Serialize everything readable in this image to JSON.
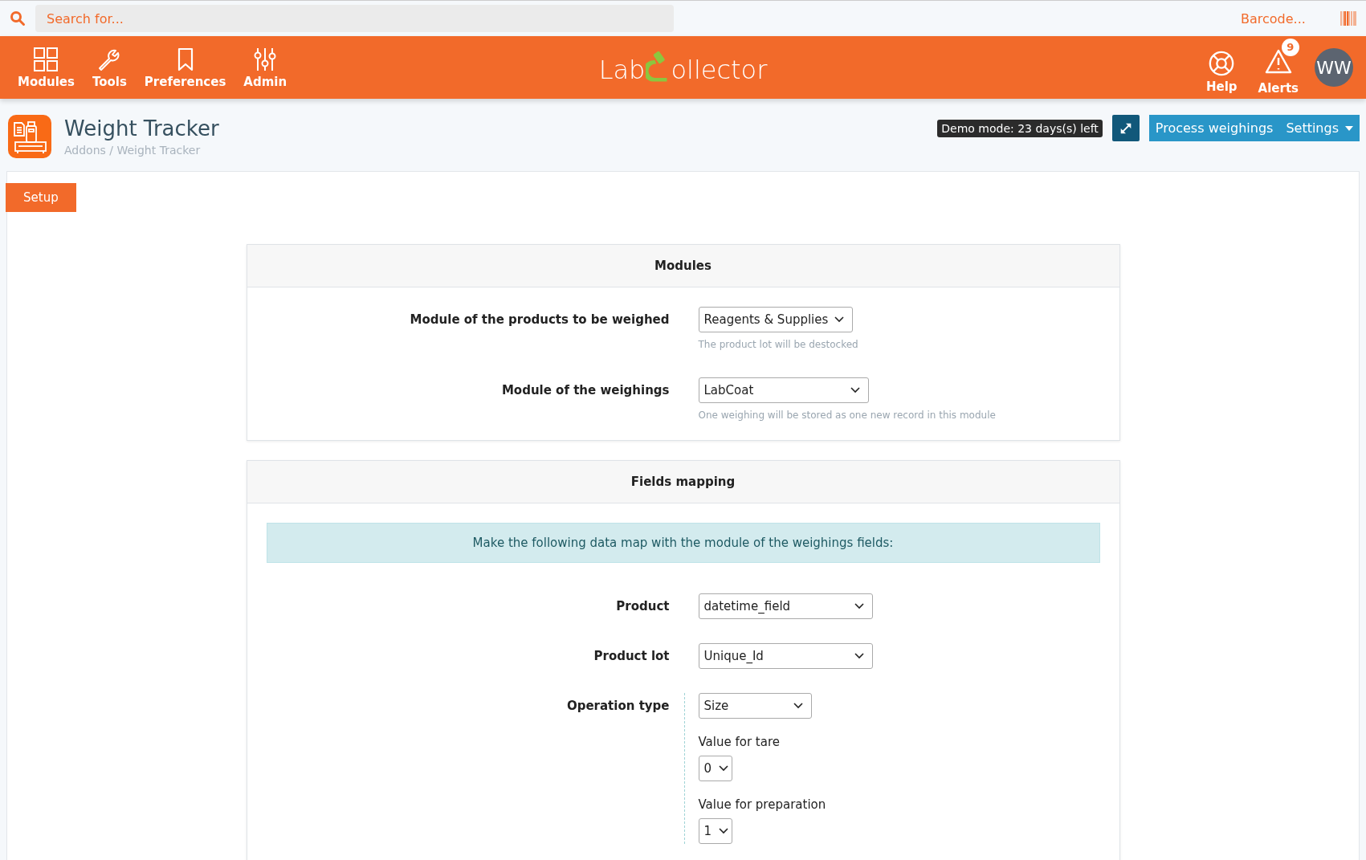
{
  "search": {
    "placeholder": "Search for..."
  },
  "barcode": {
    "placeholder": "Barcode..."
  },
  "nav": [
    {
      "label": "Modules",
      "kind": "grid"
    },
    {
      "label": "Tools",
      "kind": "wrench"
    },
    {
      "label": "Preferences",
      "kind": "bookmark"
    },
    {
      "label": "Admin",
      "kind": "sliders"
    }
  ],
  "logo": {
    "text_before": "Lab",
    "text_after": "ollector"
  },
  "nav_right": [
    {
      "label": "Help",
      "kind": "lifebuoy"
    },
    {
      "label": "Alerts",
      "kind": "alert",
      "badge": "9"
    }
  ],
  "avatar": "WW",
  "page": {
    "title": "Weight Tracker",
    "breadcrumb": "Addons / Weight Tracker"
  },
  "demo_badge": "Demo mode: 23 days(s) left",
  "actions": [
    "Process weighings",
    "Settings"
  ],
  "tabs": [
    {
      "label": "Setup",
      "selected": true
    }
  ],
  "modules_panel": {
    "title": "Modules",
    "rows": [
      {
        "label": "Module of the products to be weighed",
        "value": "Reagents & Supplies",
        "help": "The product lot will be destocked"
      },
      {
        "label": "Module of the weighings",
        "value": "LabCoat",
        "help": "One weighing will be stored as one new record in this module"
      }
    ]
  },
  "mapping_panel": {
    "title": "Fields mapping",
    "info": "Make the following data map with the module of the weighings fields:",
    "rows": [
      {
        "label": "Product",
        "value": "datetime_field"
      },
      {
        "label": "Product lot",
        "value": "Unique_Id"
      },
      {
        "label": "Operation type",
        "value": "Size",
        "sub": [
          {
            "label": "Value for tare",
            "value": "0"
          },
          {
            "label": "Value for preparation",
            "value": "1"
          }
        ]
      }
    ]
  }
}
